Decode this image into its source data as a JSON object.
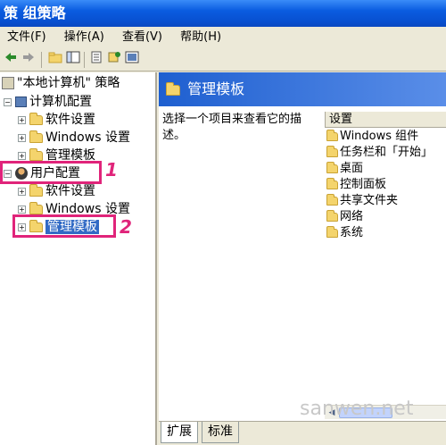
{
  "window": {
    "title": "策 组策略"
  },
  "menu": [
    {
      "label": "文件(F)"
    },
    {
      "label": "操作(A)"
    },
    {
      "label": "查看(V)"
    },
    {
      "label": "帮助(H)"
    }
  ],
  "toolbar": {
    "back_icon": "back-arrow",
    "forward_icon": "forward-arrow",
    "buttons": [
      "up-folder",
      "show-tree",
      "properties",
      "export-list",
      "help"
    ]
  },
  "tree": {
    "root": "\"本地计算机\" 策略",
    "computer_config": "计算机配置",
    "cc_software": "软件设置",
    "cc_windows": "Windows 设置",
    "cc_admin": "管理模板",
    "user_config": "用户配置",
    "uc_software": "软件设置",
    "uc_windows": "Windows 设置",
    "uc_admin": "管理模板"
  },
  "callouts": {
    "one": "1",
    "two": "2",
    "color": "#e0247a"
  },
  "right_pane": {
    "header": "管理模板",
    "description": "选择一个项目来查看它的描述。",
    "list_header": "设置",
    "items": [
      {
        "label": "Windows 组件"
      },
      {
        "label": "任务栏和「开始」"
      },
      {
        "label": "桌面"
      },
      {
        "label": "控制面板"
      },
      {
        "label": "共享文件夹"
      },
      {
        "label": "网络"
      },
      {
        "label": "系统"
      }
    ]
  },
  "tabs": [
    {
      "label": "扩展",
      "active": true
    },
    {
      "label": "标准",
      "active": false
    }
  ],
  "watermark": "sanwen.net",
  "colors": {
    "selection": "#316ac5",
    "titlebar": "#0a5ce0",
    "highlight_box": "#e0247a"
  }
}
